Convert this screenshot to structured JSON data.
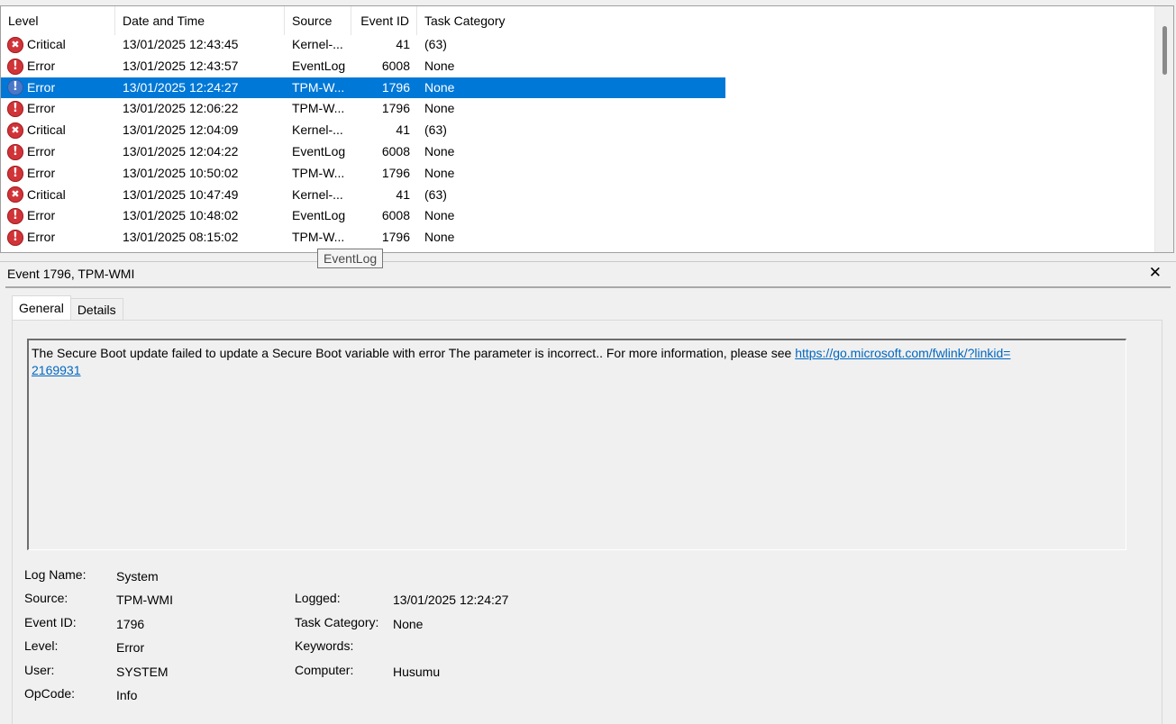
{
  "columns": {
    "level": "Level",
    "date_time": "Date and Time",
    "source": "Source",
    "event_id": "Event ID",
    "task_category": "Task Category"
  },
  "events": [
    {
      "level": "Critical",
      "icon": "critical-icon",
      "date_time": "13/01/2025 12:43:45",
      "source": "Kernel-...",
      "event_id": "41",
      "task_category": "(63)",
      "selected": false
    },
    {
      "level": "Error",
      "icon": "error-icon",
      "date_time": "13/01/2025 12:43:57",
      "source": "EventLog",
      "event_id": "6008",
      "task_category": "None",
      "selected": false
    },
    {
      "level": "Error",
      "icon": "error-icon",
      "date_time": "13/01/2025 12:24:27",
      "source": "TPM-W...",
      "event_id": "1796",
      "task_category": "None",
      "selected": true
    },
    {
      "level": "Error",
      "icon": "error-icon",
      "date_time": "13/01/2025 12:06:22",
      "source": "TPM-W...",
      "event_id": "1796",
      "task_category": "None",
      "selected": false
    },
    {
      "level": "Critical",
      "icon": "critical-icon",
      "date_time": "13/01/2025 12:04:09",
      "source": "Kernel-...",
      "event_id": "41",
      "task_category": "(63)",
      "selected": false
    },
    {
      "level": "Error",
      "icon": "error-icon",
      "date_time": "13/01/2025 12:04:22",
      "source": "EventLog",
      "event_id": "6008",
      "task_category": "None",
      "selected": false
    },
    {
      "level": "Error",
      "icon": "error-icon",
      "date_time": "13/01/2025 10:50:02",
      "source": "TPM-W...",
      "event_id": "1796",
      "task_category": "None",
      "selected": false
    },
    {
      "level": "Critical",
      "icon": "critical-icon",
      "date_time": "13/01/2025 10:47:49",
      "source": "Kernel-...",
      "event_id": "41",
      "task_category": "(63)",
      "selected": false
    },
    {
      "level": "Error",
      "icon": "error-icon",
      "date_time": "13/01/2025 10:48:02",
      "source": "EventLog",
      "event_id": "6008",
      "task_category": "None",
      "selected": false
    },
    {
      "level": "Error",
      "icon": "error-icon",
      "date_time": "13/01/2025 08:15:02",
      "source": "TPM-W...",
      "event_id": "1796",
      "task_category": "None",
      "selected": false
    }
  ],
  "tooltip": "EventLog",
  "detail": {
    "title": "Event 1796, TPM-WMI",
    "close_glyph": "✕",
    "tabs": [
      {
        "label": "General",
        "active": true
      },
      {
        "label": "Details",
        "active": false
      }
    ],
    "description_text": "The Secure Boot update failed to update a Secure Boot variable with error The parameter is incorrect.. For more information, please see ",
    "description_link": "https://go.microsoft.com/fwlink/?linkid=2169931",
    "description_link_line1": "https://go.microsoft.com/fwlink/?linkid=",
    "description_link_line2": "2169931",
    "properties": {
      "log_name": {
        "label": "Log Name:",
        "value": "System"
      },
      "source": {
        "label": "Source:",
        "value": "TPM-WMI"
      },
      "logged": {
        "label": "Logged:",
        "value": "13/01/2025 12:24:27"
      },
      "event_id": {
        "label": "Event ID:",
        "value": "1796"
      },
      "task_category": {
        "label": "Task Category:",
        "value": "None"
      },
      "level": {
        "label": "Level:",
        "value": "Error"
      },
      "keywords": {
        "label": "Keywords:",
        "value": ""
      },
      "user": {
        "label": "User:",
        "value": "SYSTEM"
      },
      "computer": {
        "label": "Computer:",
        "value": "Husumu"
      },
      "opcode": {
        "label": "OpCode:",
        "value": "Info"
      }
    }
  },
  "colors": {
    "selection": "#0078d7",
    "error_red": "#d13438",
    "link": "#0067c0"
  }
}
